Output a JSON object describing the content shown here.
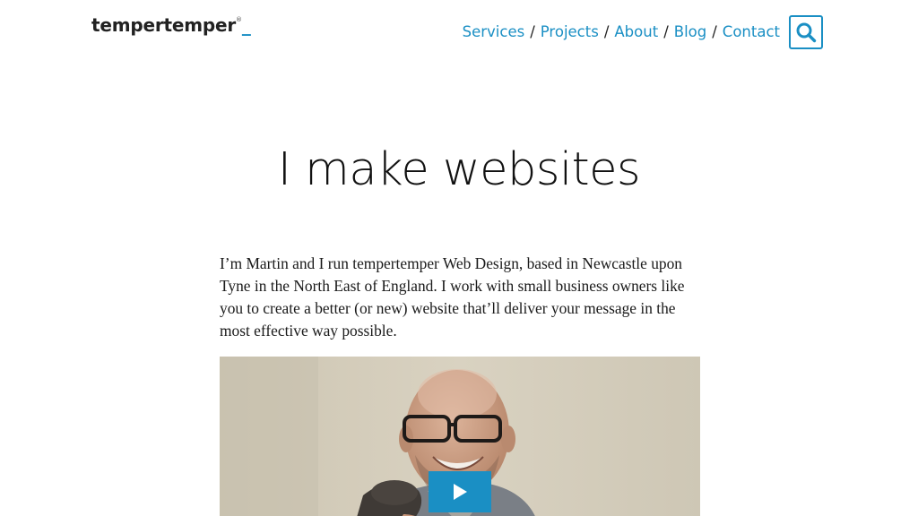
{
  "header": {
    "logo_text": "tempertemper",
    "logo_mark": "®",
    "logo_cursor": "_",
    "nav": [
      {
        "label": "Services"
      },
      {
        "label": "Projects"
      },
      {
        "label": "About"
      },
      {
        "label": "Blog"
      },
      {
        "label": "Contact"
      }
    ],
    "nav_separator": "/",
    "search_icon": "search-icon"
  },
  "main": {
    "title": "I make websites",
    "intro": "I’m Martin and I run tempertemper Web Design, based in Newcastle upon Tyne in the North East of England. I work with small business owners like you to create a better (or new) website that’ll deliver your message in the most effective way possible.",
    "video": {
      "play_icon": "play-icon"
    }
  },
  "colors": {
    "accent": "#1a8fc4",
    "text": "#1a1a1a",
    "background": "#ffffff"
  }
}
